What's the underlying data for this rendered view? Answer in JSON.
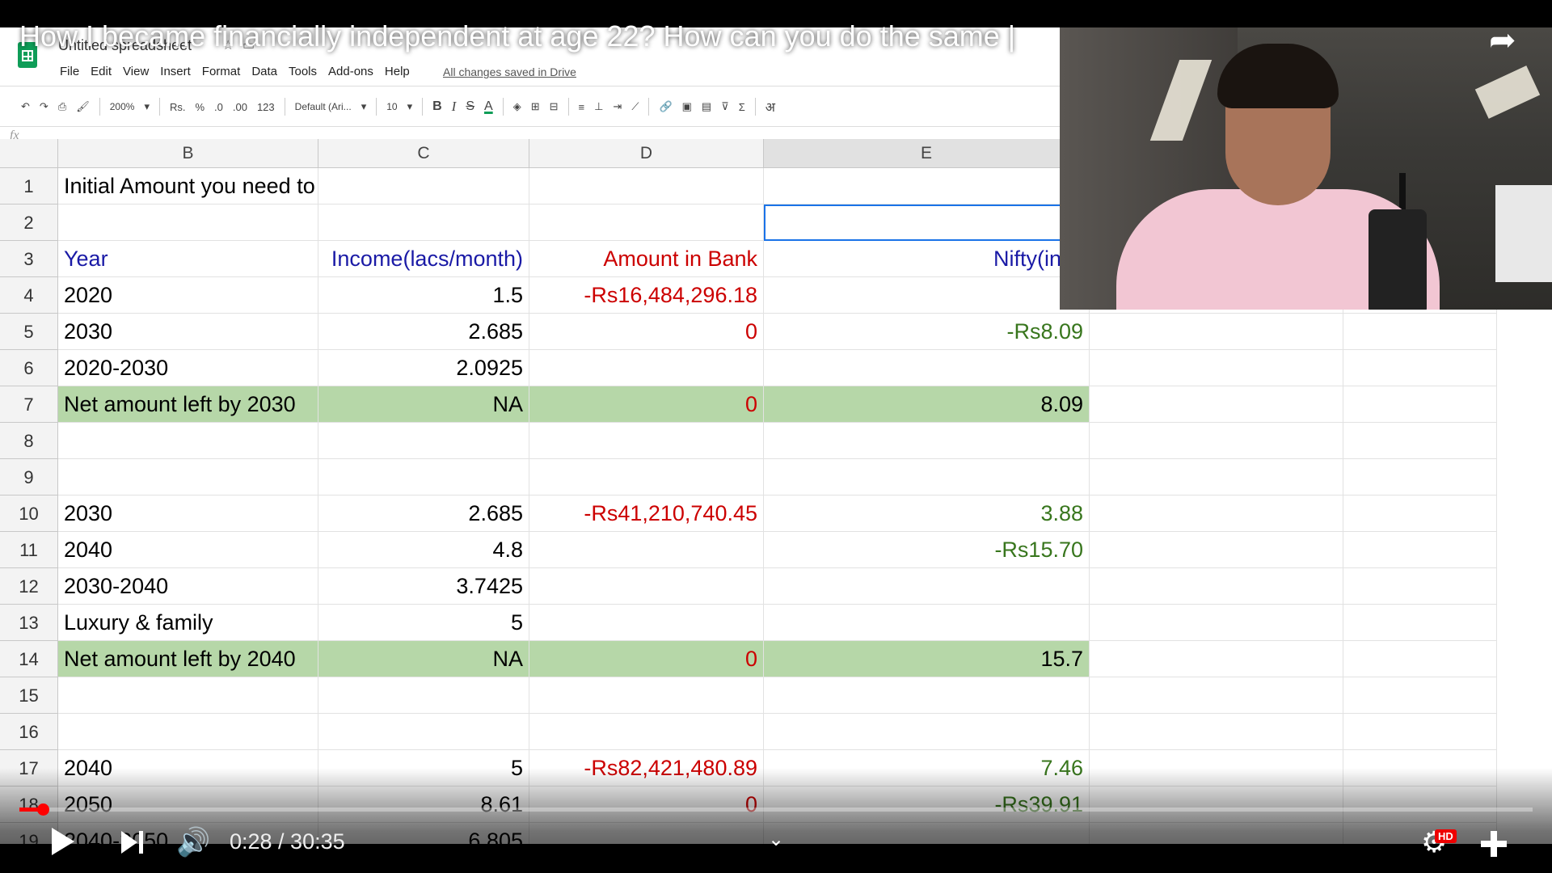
{
  "video": {
    "title": "How I became financially independent at age 22? How can you do the same |",
    "current_time": "0:28",
    "duration": "30:35",
    "time_display": "0:28 / 30:35",
    "progress": 0.0153,
    "quality_badge": "HD"
  },
  "sheet": {
    "doc_title": "Untitled spreadsheet",
    "menu": [
      "File",
      "Edit",
      "View",
      "Insert",
      "Format",
      "Data",
      "Tools",
      "Add-ons",
      "Help"
    ],
    "saved_status": "All changes saved in Drive",
    "toolbar": {
      "zoom": "200%",
      "currency": "Rs.",
      "percent": "%",
      "dec_less": ".0",
      "dec_more": ".00",
      "format_more": "123",
      "font": "Default (Ari...",
      "font_size": "10",
      "bold": "B",
      "italic": "I",
      "strike": "S",
      "text_color": "A",
      "input_tools": "अ"
    },
    "fx_label": "fx",
    "columns": [
      "B",
      "C",
      "D",
      "E"
    ],
    "rows": [
      {
        "num": "1",
        "B": "Initial Amount you need to be financially Independent : ?",
        "C": "",
        "D": "",
        "E": ""
      },
      {
        "num": "2",
        "B": "",
        "C": "",
        "D": "",
        "E": ""
      },
      {
        "num": "3",
        "B": "Year",
        "C": "Income(lacs/month)",
        "D": "Amount in Bank",
        "E": "Nifty(in C"
      },
      {
        "num": "4",
        "B": "2020",
        "C": "1.5",
        "D": "-Rs16,484,296.18",
        "E": ""
      },
      {
        "num": "5",
        "B": "2030",
        "C": "2.685",
        "D": "0",
        "E": "-Rs8.09"
      },
      {
        "num": "6",
        "B": "2020-2030",
        "C": "2.0925",
        "D": "",
        "E": ""
      },
      {
        "num": "7",
        "B": "Net amount left by 2030",
        "C": "NA",
        "D": "0",
        "E": "8.09"
      },
      {
        "num": "8",
        "B": "",
        "C": "",
        "D": "",
        "E": ""
      },
      {
        "num": "9",
        "B": "",
        "C": "",
        "D": "",
        "E": ""
      },
      {
        "num": "10",
        "B": "2030",
        "C": "2.685",
        "D": "-Rs41,210,740.45",
        "E": "3.88"
      },
      {
        "num": "11",
        "B": "2040",
        "C": "4.8",
        "D": "",
        "E": "-Rs15.70"
      },
      {
        "num": "12",
        "B": "2030-2040",
        "C": "3.7425",
        "D": "",
        "E": ""
      },
      {
        "num": "13",
        "B": "Luxury & family",
        "C": "5",
        "D": "",
        "E": ""
      },
      {
        "num": "14",
        "B": "Net amount left by 2040",
        "C": "NA",
        "D": "0",
        "E": "15.7"
      },
      {
        "num": "15",
        "B": "",
        "C": "",
        "D": "",
        "E": ""
      },
      {
        "num": "16",
        "B": "",
        "C": "",
        "D": "",
        "E": ""
      },
      {
        "num": "17",
        "B": "2040",
        "C": "5",
        "D": "-Rs82,421,480.89",
        "E": "7.46"
      },
      {
        "num": "18",
        "B": "2050",
        "C": "8.61",
        "D": "0",
        "E": "-Rs39.91"
      },
      {
        "num": "19",
        "B": "2040-2050",
        "C": "6.805",
        "D": "",
        "E": ""
      }
    ]
  },
  "colors": {
    "header_text": "#1a1aa6",
    "negative": "#cc0000",
    "positive_green": "#38761d",
    "highlight_row": "#b6d7a8",
    "progress": "#ff0000"
  },
  "icons": [
    "sheets-logo-icon",
    "undo-icon",
    "redo-icon",
    "print-icon",
    "paint-format-icon",
    "fill-color-icon",
    "borders-icon",
    "merge-icon",
    "align-icon",
    "valign-icon",
    "wrap-icon",
    "rotate-icon",
    "link-icon",
    "comment-icon",
    "chart-icon",
    "filter-icon",
    "functions-icon",
    "share-icon",
    "play-icon",
    "next-icon",
    "volume-icon",
    "chevron-down-icon",
    "settings-gear-icon",
    "exit-fullscreen-icon"
  ]
}
